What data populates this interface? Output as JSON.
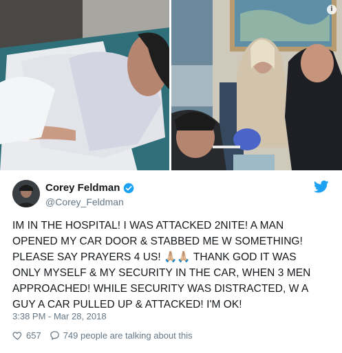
{
  "tweet": {
    "display_name": "Corey Feldman",
    "handle": "@Corey_Feldman",
    "body": "IM IN THE HOSPITAL! I WAS ATTACKED 2NITE! A MAN\nOPENED MY CAR DOOR & STABBED ME W SOMETHING!\nPLEASE SAY PRAYERS 4 US! 🙏🏼🙏🏼 THANK GOD IT WAS\nONLY MYSELF & MY SECURITY IN THE CAR, WHEN 3 MEN\nAPPROACHED! WHILE SECURITY WAS DISTRACTED, W A\nGUY A CAR PULLED UP & ATTACKED! I'M OK!",
    "timestamp": "3:38 PM - Mar 28, 2018",
    "likes": "657",
    "replies_text": "749 people are talking about this"
  },
  "icons": {
    "verified": "verified-badge-icon",
    "brand": "twitter-bird-icon",
    "like": "heart-icon",
    "reply": "speech-bubble-icon",
    "info": "info-icon"
  },
  "colors": {
    "brand_blue": "#1da1f2",
    "secondary_text": "#657786",
    "primary_text": "#14171a"
  }
}
